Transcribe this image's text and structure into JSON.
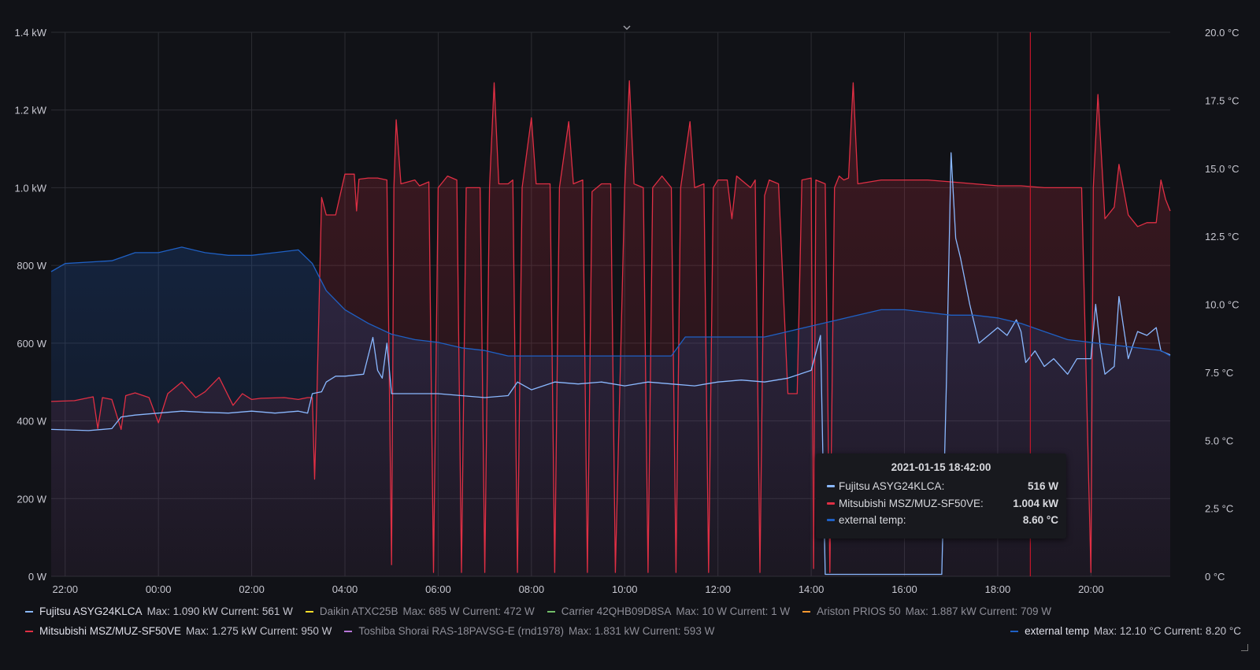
{
  "chart_data": {
    "type": "line",
    "x_label_times": [
      "22:00",
      "00:00",
      "02:00",
      "04:00",
      "06:00",
      "08:00",
      "10:00",
      "12:00",
      "14:00",
      "16:00",
      "18:00",
      "20:00"
    ],
    "y_left": {
      "ticks": [
        "0 W",
        "200 W",
        "400 W",
        "600 W",
        "800 W",
        "1.0 kW",
        "1.2 kW",
        "1.4 kW"
      ],
      "range": [
        0,
        1400
      ],
      "unit": "W"
    },
    "y_right": {
      "ticks": [
        "0 °C",
        "2.5 °C",
        "5.0 °C",
        "7.5 °C",
        "10.0 °C",
        "12.5 °C",
        "15.0 °C",
        "17.5 °C",
        "20.0 °C"
      ],
      "range": [
        0,
        20
      ],
      "unit": "°C"
    },
    "x_range_hours": [
      21.7,
      45.7
    ],
    "marker_hours": 42.7,
    "grid": true,
    "legend_placement": "bottom",
    "series": [
      {
        "name": "Mitsubishi MSZ/MUZ-SF50VE",
        "axis": "left",
        "color": "#e02f44",
        "fill": true,
        "points": [
          [
            21.7,
            450
          ],
          [
            22.2,
            452
          ],
          [
            22.6,
            462
          ],
          [
            22.7,
            380
          ],
          [
            22.8,
            460
          ],
          [
            23.0,
            455
          ],
          [
            23.2,
            378
          ],
          [
            23.3,
            465
          ],
          [
            23.5,
            472
          ],
          [
            23.8,
            460
          ],
          [
            24.0,
            395
          ],
          [
            24.2,
            470
          ],
          [
            24.5,
            500
          ],
          [
            24.8,
            460
          ],
          [
            25.0,
            475
          ],
          [
            25.3,
            512
          ],
          [
            25.6,
            440
          ],
          [
            25.8,
            470
          ],
          [
            26.0,
            455
          ],
          [
            26.2,
            458
          ],
          [
            26.7,
            460
          ],
          [
            27.0,
            455
          ],
          [
            27.2,
            460
          ],
          [
            27.3,
            460
          ],
          [
            27.35,
            250
          ],
          [
            27.4,
            470
          ],
          [
            27.5,
            975
          ],
          [
            27.6,
            930
          ],
          [
            27.8,
            930
          ],
          [
            28.0,
            1035
          ],
          [
            28.2,
            1035
          ],
          [
            28.25,
            940
          ],
          [
            28.3,
            1022
          ],
          [
            28.5,
            1025
          ],
          [
            28.7,
            1025
          ],
          [
            28.9,
            1020
          ],
          [
            29.0,
            30
          ],
          [
            29.05,
            1000
          ],
          [
            29.1,
            1175
          ],
          [
            29.2,
            1010
          ],
          [
            29.5,
            1020
          ],
          [
            29.6,
            1005
          ],
          [
            29.8,
            1015
          ],
          [
            29.9,
            10
          ],
          [
            30.0,
            1000
          ],
          [
            30.2,
            1030
          ],
          [
            30.4,
            1020
          ],
          [
            30.5,
            10
          ],
          [
            30.6,
            1000
          ],
          [
            30.8,
            1000
          ],
          [
            30.9,
            1000
          ],
          [
            31.0,
            10
          ],
          [
            31.1,
            1000
          ],
          [
            31.2,
            1270
          ],
          [
            31.3,
            1010
          ],
          [
            31.5,
            1010
          ],
          [
            31.6,
            1020
          ],
          [
            31.7,
            10
          ],
          [
            31.8,
            1000
          ],
          [
            32.0,
            1180
          ],
          [
            32.1,
            1010
          ],
          [
            32.4,
            1010
          ],
          [
            32.5,
            10
          ],
          [
            32.6,
            1000
          ],
          [
            32.8,
            1170
          ],
          [
            32.9,
            1010
          ],
          [
            33.1,
            1020
          ],
          [
            33.2,
            10
          ],
          [
            33.3,
            990
          ],
          [
            33.5,
            1010
          ],
          [
            33.7,
            1010
          ],
          [
            33.8,
            10
          ],
          [
            34.0,
            1000
          ],
          [
            34.1,
            1275
          ],
          [
            34.2,
            1010
          ],
          [
            34.4,
            1000
          ],
          [
            34.5,
            10
          ],
          [
            34.6,
            1000
          ],
          [
            34.8,
            1030
          ],
          [
            35.0,
            1000
          ],
          [
            35.1,
            10
          ],
          [
            35.2,
            1000
          ],
          [
            35.4,
            1170
          ],
          [
            35.5,
            1000
          ],
          [
            35.7,
            1010
          ],
          [
            35.8,
            10
          ],
          [
            35.9,
            1000
          ],
          [
            36.0,
            1020
          ],
          [
            36.2,
            1020
          ],
          [
            36.3,
            920
          ],
          [
            36.4,
            1030
          ],
          [
            36.5,
            1020
          ],
          [
            36.7,
            1000
          ],
          [
            36.8,
            1020
          ],
          [
            36.9,
            10
          ],
          [
            37.0,
            980
          ],
          [
            37.1,
            1020
          ],
          [
            37.3,
            1010
          ],
          [
            37.5,
            470
          ],
          [
            37.7,
            470
          ],
          [
            37.8,
            1020
          ],
          [
            38.0,
            1025
          ],
          [
            38.05,
            20
          ],
          [
            38.1,
            1020
          ],
          [
            38.3,
            1010
          ],
          [
            38.4,
            10
          ],
          [
            38.5,
            1000
          ],
          [
            38.6,
            1030
          ],
          [
            38.7,
            1020
          ],
          [
            38.8,
            1025
          ],
          [
            38.9,
            1270
          ],
          [
            39.0,
            1010
          ],
          [
            39.5,
            1020
          ],
          [
            40.0,
            1020
          ],
          [
            40.5,
            1020
          ],
          [
            41.0,
            1015
          ],
          [
            41.5,
            1010
          ],
          [
            42.0,
            1005
          ],
          [
            42.5,
            1005
          ],
          [
            43.0,
            1000
          ],
          [
            43.5,
            1000
          ],
          [
            43.8,
            1000
          ],
          [
            44.0,
            10
          ],
          [
            44.05,
            1000
          ],
          [
            44.15,
            1240
          ],
          [
            44.3,
            920
          ],
          [
            44.5,
            950
          ],
          [
            44.6,
            1060
          ],
          [
            44.8,
            930
          ],
          [
            45.0,
            900
          ],
          [
            45.2,
            910
          ],
          [
            45.4,
            910
          ],
          [
            45.5,
            1020
          ],
          [
            45.6,
            970
          ],
          [
            45.7,
            940
          ]
        ]
      },
      {
        "name": "Fujitsu ASYG24KLCA",
        "axis": "left",
        "color": "#8ab8ff",
        "fill": false,
        "points": [
          [
            21.7,
            378
          ],
          [
            22.5,
            375
          ],
          [
            23.0,
            380
          ],
          [
            23.2,
            410
          ],
          [
            23.5,
            415
          ],
          [
            24.0,
            420
          ],
          [
            24.5,
            425
          ],
          [
            25.0,
            422
          ],
          [
            25.5,
            420
          ],
          [
            26.0,
            425
          ],
          [
            26.5,
            420
          ],
          [
            27.0,
            425
          ],
          [
            27.2,
            420
          ],
          [
            27.3,
            470
          ],
          [
            27.5,
            475
          ],
          [
            27.6,
            500
          ],
          [
            27.8,
            515
          ],
          [
            28.0,
            515
          ],
          [
            28.4,
            520
          ],
          [
            28.6,
            615
          ],
          [
            28.7,
            530
          ],
          [
            28.8,
            510
          ],
          [
            28.9,
            600
          ],
          [
            29.0,
            470
          ],
          [
            29.5,
            470
          ],
          [
            30.0,
            470
          ],
          [
            30.5,
            465
          ],
          [
            31.0,
            460
          ],
          [
            31.5,
            465
          ],
          [
            31.7,
            500
          ],
          [
            32.0,
            480
          ],
          [
            32.5,
            500
          ],
          [
            33.0,
            495
          ],
          [
            33.5,
            500
          ],
          [
            34.0,
            490
          ],
          [
            34.5,
            500
          ],
          [
            35.0,
            495
          ],
          [
            35.5,
            490
          ],
          [
            36.0,
            500
          ],
          [
            36.5,
            505
          ],
          [
            37.0,
            500
          ],
          [
            37.5,
            510
          ],
          [
            38.0,
            530
          ],
          [
            38.2,
            620
          ],
          [
            38.3,
            5
          ],
          [
            39.0,
            5
          ],
          [
            39.5,
            5
          ],
          [
            40.0,
            5
          ],
          [
            40.5,
            5
          ],
          [
            40.8,
            5
          ],
          [
            40.9,
            500
          ],
          [
            41.0,
            1090
          ],
          [
            41.1,
            870
          ],
          [
            41.2,
            820
          ],
          [
            41.4,
            700
          ],
          [
            41.6,
            600
          ],
          [
            41.8,
            620
          ],
          [
            42.0,
            640
          ],
          [
            42.2,
            620
          ],
          [
            42.4,
            660
          ],
          [
            42.5,
            630
          ],
          [
            42.6,
            550
          ],
          [
            42.8,
            580
          ],
          [
            43.0,
            540
          ],
          [
            43.2,
            560
          ],
          [
            43.5,
            520
          ],
          [
            43.7,
            560
          ],
          [
            44.0,
            560
          ],
          [
            44.1,
            700
          ],
          [
            44.2,
            590
          ],
          [
            44.3,
            520
          ],
          [
            44.5,
            540
          ],
          [
            44.6,
            720
          ],
          [
            44.8,
            560
          ],
          [
            45.0,
            630
          ],
          [
            45.2,
            620
          ],
          [
            45.4,
            640
          ],
          [
            45.5,
            580
          ],
          [
            45.7,
            570
          ]
        ]
      },
      {
        "name": "external temp",
        "axis": "right",
        "color": "#1f60c4",
        "fill": true,
        "points": [
          [
            21.7,
            11.2
          ],
          [
            22.0,
            11.5
          ],
          [
            23.0,
            11.6
          ],
          [
            23.5,
            11.9
          ],
          [
            24.0,
            11.9
          ],
          [
            24.5,
            12.1
          ],
          [
            25.0,
            11.9
          ],
          [
            25.5,
            11.8
          ],
          [
            26.0,
            11.8
          ],
          [
            26.5,
            11.9
          ],
          [
            27.0,
            12.0
          ],
          [
            27.3,
            11.5
          ],
          [
            27.6,
            10.5
          ],
          [
            28.0,
            9.8
          ],
          [
            28.5,
            9.3
          ],
          [
            29.0,
            8.9
          ],
          [
            29.5,
            8.7
          ],
          [
            30.0,
            8.6
          ],
          [
            30.5,
            8.4
          ],
          [
            31.0,
            8.3
          ],
          [
            31.5,
            8.1
          ],
          [
            32.0,
            8.1
          ],
          [
            32.5,
            8.1
          ],
          [
            33.0,
            8.1
          ],
          [
            34.0,
            8.1
          ],
          [
            35.0,
            8.1
          ],
          [
            35.3,
            8.8
          ],
          [
            36.0,
            8.8
          ],
          [
            36.5,
            8.8
          ],
          [
            37.0,
            8.8
          ],
          [
            37.5,
            9.0
          ],
          [
            38.0,
            9.2
          ],
          [
            38.5,
            9.4
          ],
          [
            39.0,
            9.6
          ],
          [
            39.5,
            9.8
          ],
          [
            40.0,
            9.8
          ],
          [
            40.5,
            9.7
          ],
          [
            41.0,
            9.6
          ],
          [
            41.5,
            9.6
          ],
          [
            42.0,
            9.5
          ],
          [
            42.5,
            9.3
          ],
          [
            43.0,
            9.0
          ],
          [
            43.5,
            8.7
          ],
          [
            44.0,
            8.6
          ],
          [
            44.5,
            8.5
          ],
          [
            45.0,
            8.4
          ],
          [
            45.5,
            8.3
          ],
          [
            45.7,
            8.1
          ]
        ]
      }
    ]
  },
  "tooltip": {
    "time": "2021-01-15 18:42:00",
    "rows": [
      {
        "name": "Fujitsu ASYG24KLCA:",
        "value": "516 W",
        "color": "#8ab8ff"
      },
      {
        "name": "Mitsubishi MSZ/MUZ-SF50VE:",
        "value": "1.004 kW",
        "color": "#e02f44"
      },
      {
        "name": "external temp:",
        "value": "8.60 °C",
        "color": "#1f60c4"
      }
    ]
  },
  "legend": {
    "row1": [
      {
        "name": "Fujitsu ASYG24KLCA",
        "stats": "Max: 1.090 kW  Current: 561 W",
        "color": "#8ab8ff",
        "active": true
      },
      {
        "name": "Daikin ATXC25B",
        "stats": "Max: 685 W  Current: 472 W",
        "color": "#fade2a",
        "active": false
      },
      {
        "name": "Carrier 42QHB09D8SA",
        "stats": "Max: 10 W  Current: 1 W",
        "color": "#73bf69",
        "active": false
      },
      {
        "name": "Ariston PRIOS 50",
        "stats": "Max: 1.887 kW  Current: 709 W",
        "color": "#ff9830",
        "active": false
      }
    ],
    "row2": [
      {
        "name": "Mitsubishi MSZ/MUZ-SF50VE",
        "stats": "Max: 1.275 kW  Current: 950 W",
        "color": "#e02f44",
        "active": true
      },
      {
        "name": "Toshiba Shorai RAS-18PAVSG-E (rnd1978)",
        "stats": "Max: 1.831 kW  Current: 593 W",
        "color": "#b877d9",
        "active": false
      }
    ],
    "right": {
      "name": "external temp",
      "stats": "Max: 12.10 °C  Current: 8.20 °C",
      "color": "#1f60c4",
      "active": true
    }
  }
}
